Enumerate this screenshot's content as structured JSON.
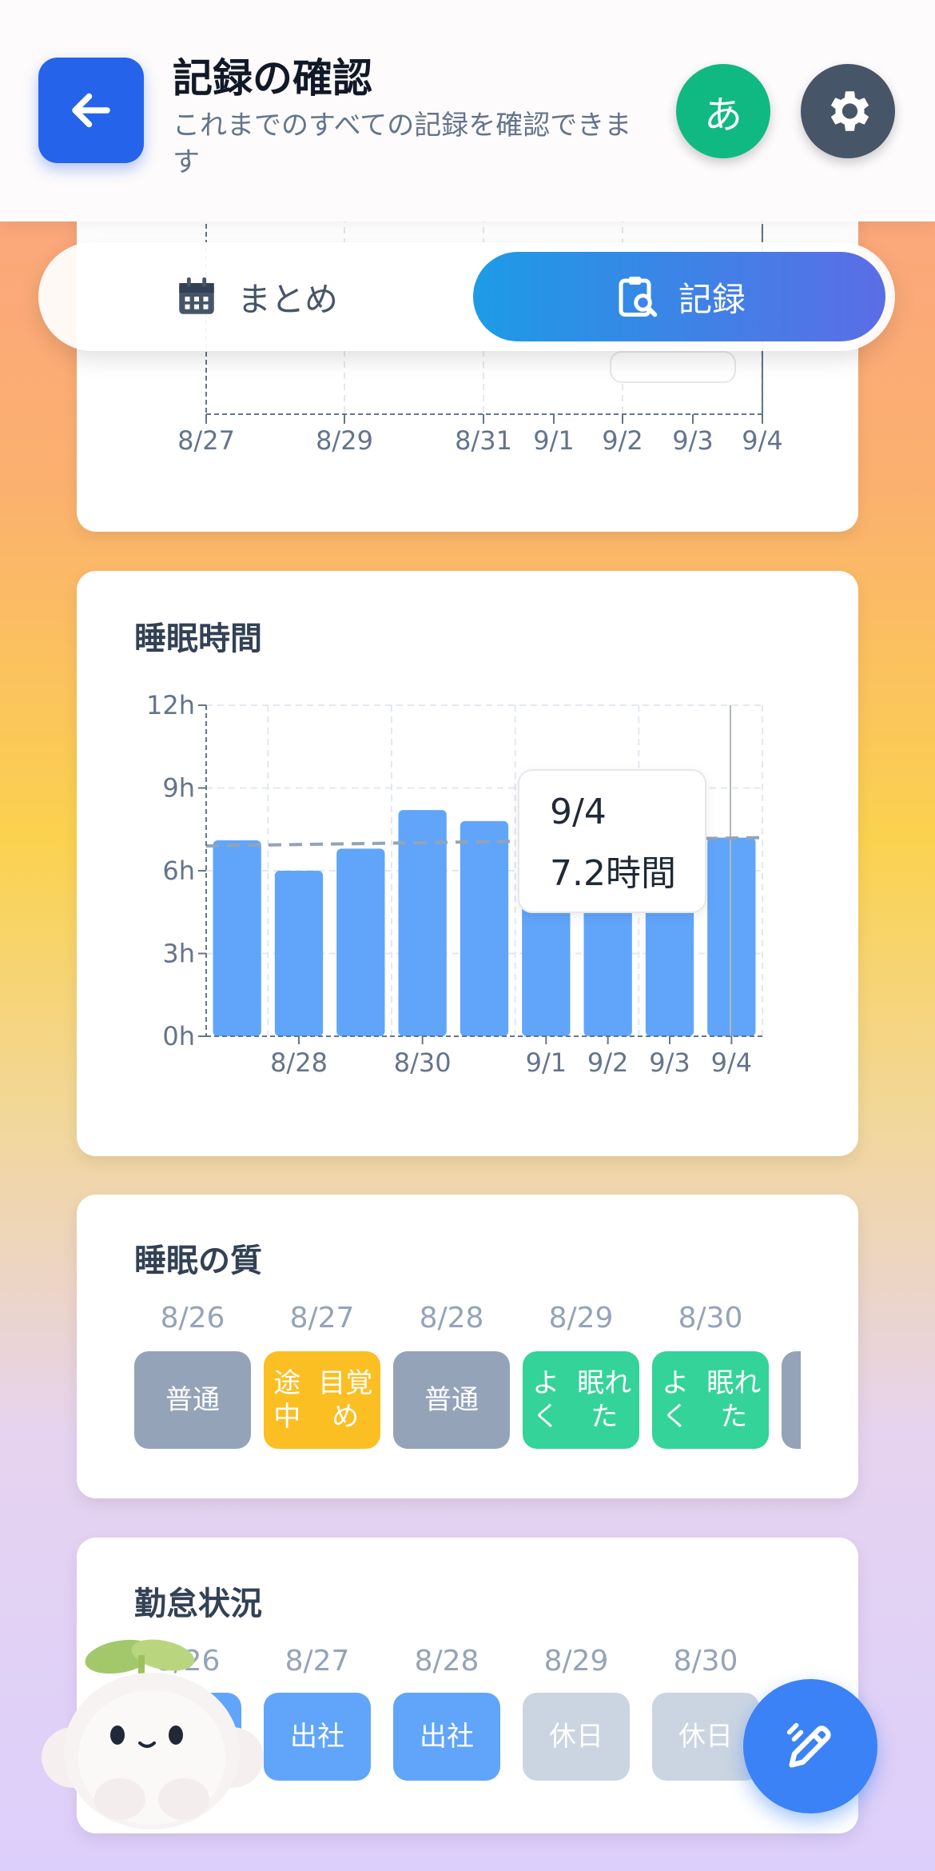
{
  "header": {
    "title": "記録の確認",
    "subtitle": "これまでのすべての記録を確認できます",
    "lang_label": "あ"
  },
  "tabs": [
    {
      "label": "まとめ",
      "active": false
    },
    {
      "label": "記録",
      "active": true
    }
  ],
  "top_chart": {
    "x_ticks": [
      "8/27",
      "8/29",
      "8/31",
      "9/1",
      "9/2",
      "9/3",
      "9/4"
    ]
  },
  "sleep_time": {
    "title": "睡眠時間",
    "tooltip_date": "9/4",
    "tooltip_value": "7.2時間"
  },
  "chart_data": {
    "type": "bar",
    "title": "睡眠時間",
    "categories": [
      "8/27",
      "8/28",
      "8/29",
      "8/30",
      "8/31",
      "9/1",
      "9/2",
      "9/3",
      "9/4"
    ],
    "x_tick_labels": [
      "8/28",
      "8/30",
      "9/1",
      "9/2",
      "9/3",
      "9/4"
    ],
    "values": [
      7.1,
      6.0,
      6.8,
      8.2,
      7.8,
      7.3,
      7.4,
      7.0,
      7.2
    ],
    "average_line": [
      6.9,
      7.2
    ],
    "y_ticks": [
      "0h",
      "3h",
      "6h",
      "9h",
      "12h"
    ],
    "ylim": [
      0,
      12
    ],
    "grid": true,
    "bar_color": "#60a5fa"
  },
  "sleep_quality": {
    "title": "睡眠の質",
    "items": [
      {
        "date": "8/26",
        "label": "普通",
        "color": "#94a3b8"
      },
      {
        "date": "8/27",
        "label": "途中\n目覚め",
        "color": "#fbbf24"
      },
      {
        "date": "8/28",
        "label": "普通",
        "color": "#94a3b8"
      },
      {
        "date": "8/29",
        "label": "よく\n眠れた",
        "color": "#34d399"
      },
      {
        "date": "8/30",
        "label": "よく\n眠れた",
        "color": "#34d399"
      },
      {
        "date": "",
        "label": "",
        "color": "#94a3b8"
      }
    ]
  },
  "attendance": {
    "title": "勤怠状況",
    "items": [
      {
        "date": "8/26",
        "label": "",
        "color": "#60a5fa"
      },
      {
        "date": "8/27",
        "label": "出社",
        "color": "#60a5fa"
      },
      {
        "date": "8/28",
        "label": "出社",
        "color": "#60a5fa"
      },
      {
        "date": "8/29",
        "label": "休日",
        "color": "#cbd5e1"
      },
      {
        "date": "8/30",
        "label": "休日",
        "color": "#cbd5e1"
      }
    ]
  }
}
